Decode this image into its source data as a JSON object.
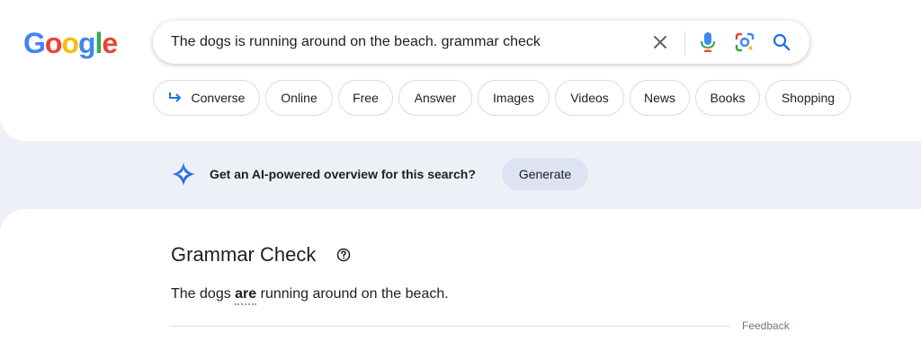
{
  "logo": {
    "letters": [
      "G",
      "o",
      "o",
      "g",
      "l",
      "e"
    ],
    "colors": [
      "#4285F4",
      "#EA4335",
      "#FBBC05",
      "#4285F4",
      "#34A853",
      "#EA4335"
    ]
  },
  "search": {
    "query": "The dogs is running around on the beach. grammar check"
  },
  "icons": {
    "clear": "close-icon",
    "voice": "microphone-icon",
    "lens": "lens-icon",
    "search": "search-icon"
  },
  "chips": [
    {
      "label": "Converse",
      "icon": "arrow-return-icon"
    },
    {
      "label": "Online"
    },
    {
      "label": "Free"
    },
    {
      "label": "Answer"
    },
    {
      "label": "Images"
    },
    {
      "label": "Videos"
    },
    {
      "label": "News"
    },
    {
      "label": "Books"
    },
    {
      "label": "Shopping"
    }
  ],
  "ai_overview": {
    "prompt": "Get an AI-powered overview for this search?",
    "button": "Generate"
  },
  "grammar_check": {
    "title": "Grammar Check",
    "sentence_before": "The dogs ",
    "corrected_word": "are",
    "sentence_after": " running around on the beach.",
    "feedback": "Feedback"
  },
  "colors": {
    "accent": "#1a73e8",
    "chip_border": "#dadce0",
    "generate_bg": "#dde3f3",
    "band_bg": "#eef0f8"
  }
}
